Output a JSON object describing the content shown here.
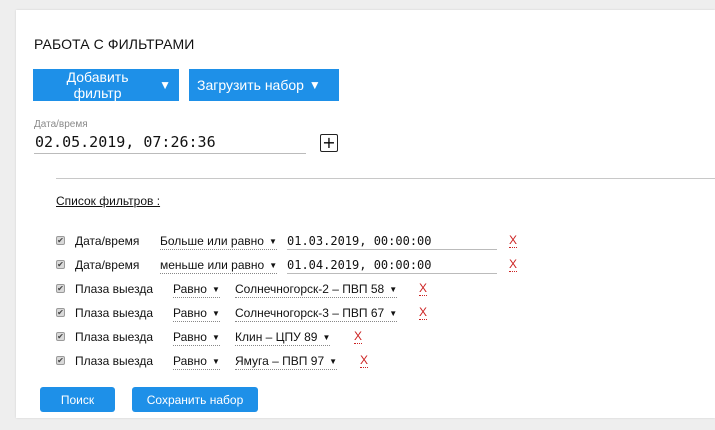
{
  "header": {
    "title": "РАБОТА С ФИЛЬТРАМИ"
  },
  "toolbar": {
    "add_filter_label": "Добавить фильтр",
    "load_set_label": "Загрузить набор",
    "caret": "▼"
  },
  "datetime": {
    "label": "Дата/время",
    "value": "02.05.2019, 07:26:36",
    "plus": "+"
  },
  "filters": {
    "list_title": "Список фильтров :",
    "items": [
      {
        "checked": true,
        "name": "Дата/время",
        "operator": "Больше или равно",
        "value": "01.03.2019, 00:00:00",
        "value_type": "input",
        "remove": "X"
      },
      {
        "checked": true,
        "name": "Дата/время",
        "operator": "меньше или равно",
        "value": "01.04.2019, 00:00:00",
        "value_type": "input",
        "remove": "X"
      },
      {
        "checked": true,
        "name": "Плаза выезда",
        "operator": "Равно",
        "value": "Солнечногорск-2 – ПВП 58",
        "value_type": "select",
        "remove": "X"
      },
      {
        "checked": true,
        "name": "Плаза выезда",
        "operator": "Равно",
        "value": "Солнечногорск-3 – ПВП 67",
        "value_type": "select",
        "remove": "X"
      },
      {
        "checked": true,
        "name": "Плаза выезда",
        "operator": "Равно",
        "value": "Клин – ЦПУ 89",
        "value_type": "select",
        "remove": "X"
      },
      {
        "checked": true,
        "name": "Плаза выезда",
        "operator": "Равно",
        "value": "Ямуга – ПВП 97",
        "value_type": "select",
        "remove": "X"
      }
    ]
  },
  "actions": {
    "search_label": "Поиск",
    "save_set_label": "Сохранить набор"
  },
  "colors": {
    "accent": "#1e90e8",
    "delete": "#cc2222"
  }
}
